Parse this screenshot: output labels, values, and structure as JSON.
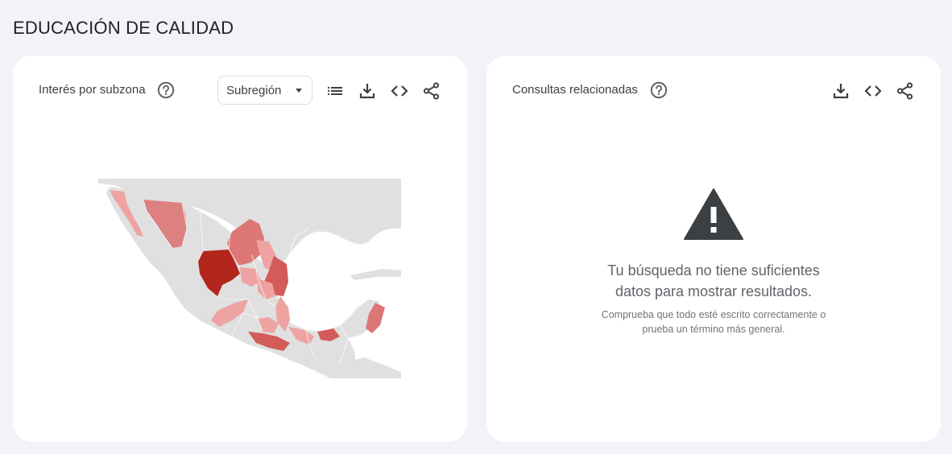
{
  "page": {
    "title": "EDUCACIÓN DE CALIDAD"
  },
  "left_card": {
    "title": "Interés por subzona",
    "select_value": "Subregión",
    "icons": [
      "help-icon",
      "list-icon",
      "download-icon",
      "embed-icon",
      "share-icon"
    ],
    "map_colors": {
      "land": "#e0e0e0",
      "light": "#eea3a2",
      "medium": "#dd7775",
      "strong": "#d35b58",
      "strongest": "#b3261e"
    }
  },
  "right_card": {
    "title": "Consultas relacionadas",
    "icons": [
      "help-icon",
      "download-icon",
      "embed-icon",
      "share-icon",
      "warning-icon"
    ],
    "message_line1": "Tu búsqueda no tiene suficientes",
    "message_line2": "datos para mostrar resultados.",
    "hint_line1": "Comprueba que todo esté escrito correctamente o",
    "hint_line2": "prueba un término más general."
  }
}
